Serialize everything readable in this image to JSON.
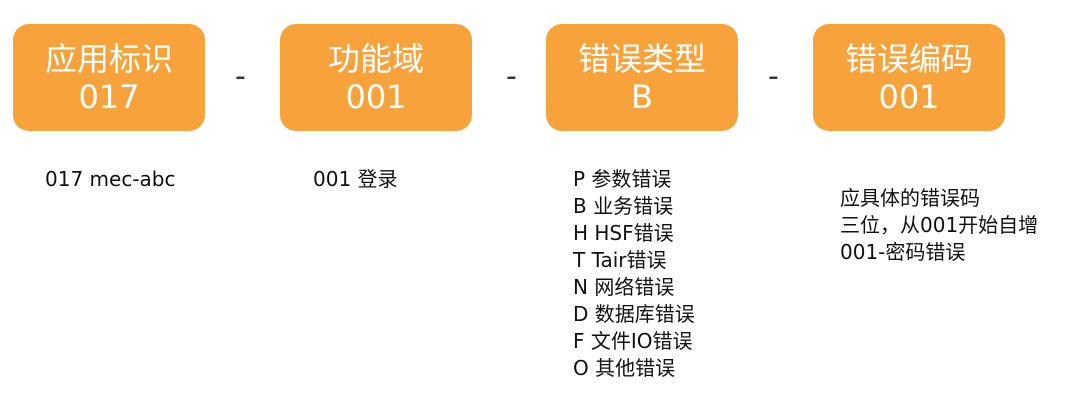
{
  "boxes": [
    {
      "title": "应用标识",
      "code": "017"
    },
    {
      "title": "功能域",
      "code": "001"
    },
    {
      "title": "错误类型",
      "code": "B"
    },
    {
      "title": "错误编码",
      "code": "001"
    }
  ],
  "separators": [
    "-",
    "-",
    "-"
  ],
  "descriptions": [
    {
      "lines": [
        "017 mec-abc"
      ]
    },
    {
      "lines": [
        "001 登录"
      ]
    },
    {
      "lines": [
        "P 参数错误",
        "B 业务错误",
        "H HSF错误",
        "T Tair错误",
        "N 网络错误",
        "D 数据库错误",
        "F 文件IO错误",
        "O 其他错误"
      ]
    },
    {
      "lines": [
        "应具体的错误码",
        "三位，从001开始自增",
        "001-密码错误"
      ]
    }
  ],
  "colors": {
    "box_fill": "#f7a23b",
    "box_text": "#ffffff",
    "text": "#111111"
  }
}
